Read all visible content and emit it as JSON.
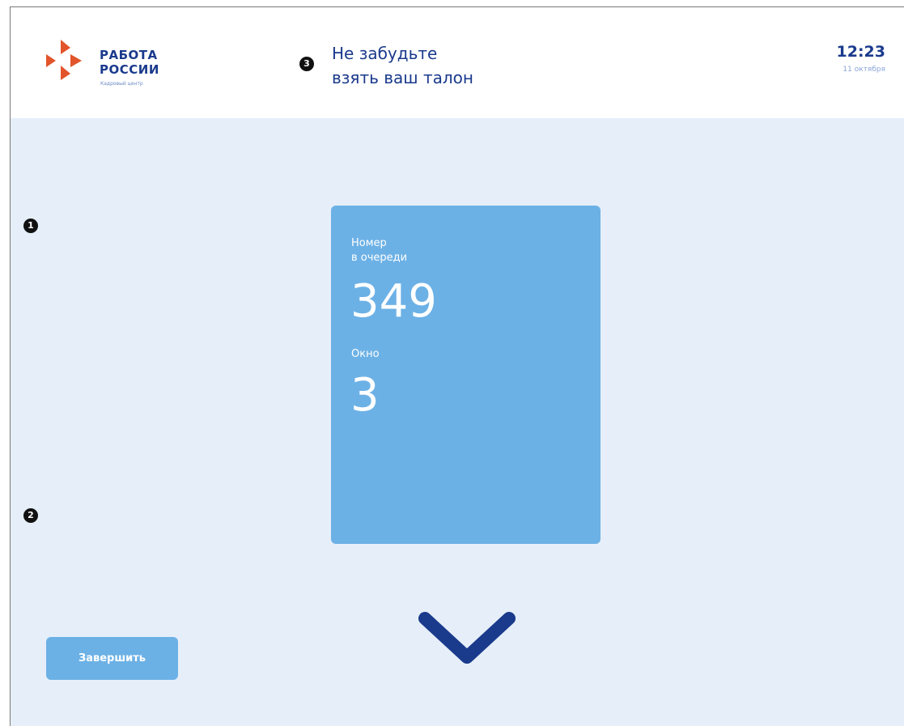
{
  "logo": {
    "line1": "РАБОТА",
    "line2": "РОССИИ",
    "subtitle": "Кадровый центр",
    "icon": "arrows-logo-icon",
    "color_primary": "#1a3a8c",
    "color_arrows": "#e2542b"
  },
  "header": {
    "reminder_line1": "Не забудьте",
    "reminder_line2": "взять ваш талон",
    "time": "12:23",
    "date": "11 октября"
  },
  "markers": [
    "1",
    "2",
    "3"
  ],
  "ticket": {
    "queue_label_line1": "Номер",
    "queue_label_line2": "в очереди",
    "queue_number": "349",
    "window_label": "Окно",
    "window_number": "3",
    "color": "#6cb1e6"
  },
  "actions": {
    "finish_label": "Завершить"
  },
  "indicator": {
    "icon": "chevron-down-icon",
    "color": "#1a3a8c"
  },
  "colors": {
    "background": "#e6eff9",
    "header": "#ffffff"
  }
}
